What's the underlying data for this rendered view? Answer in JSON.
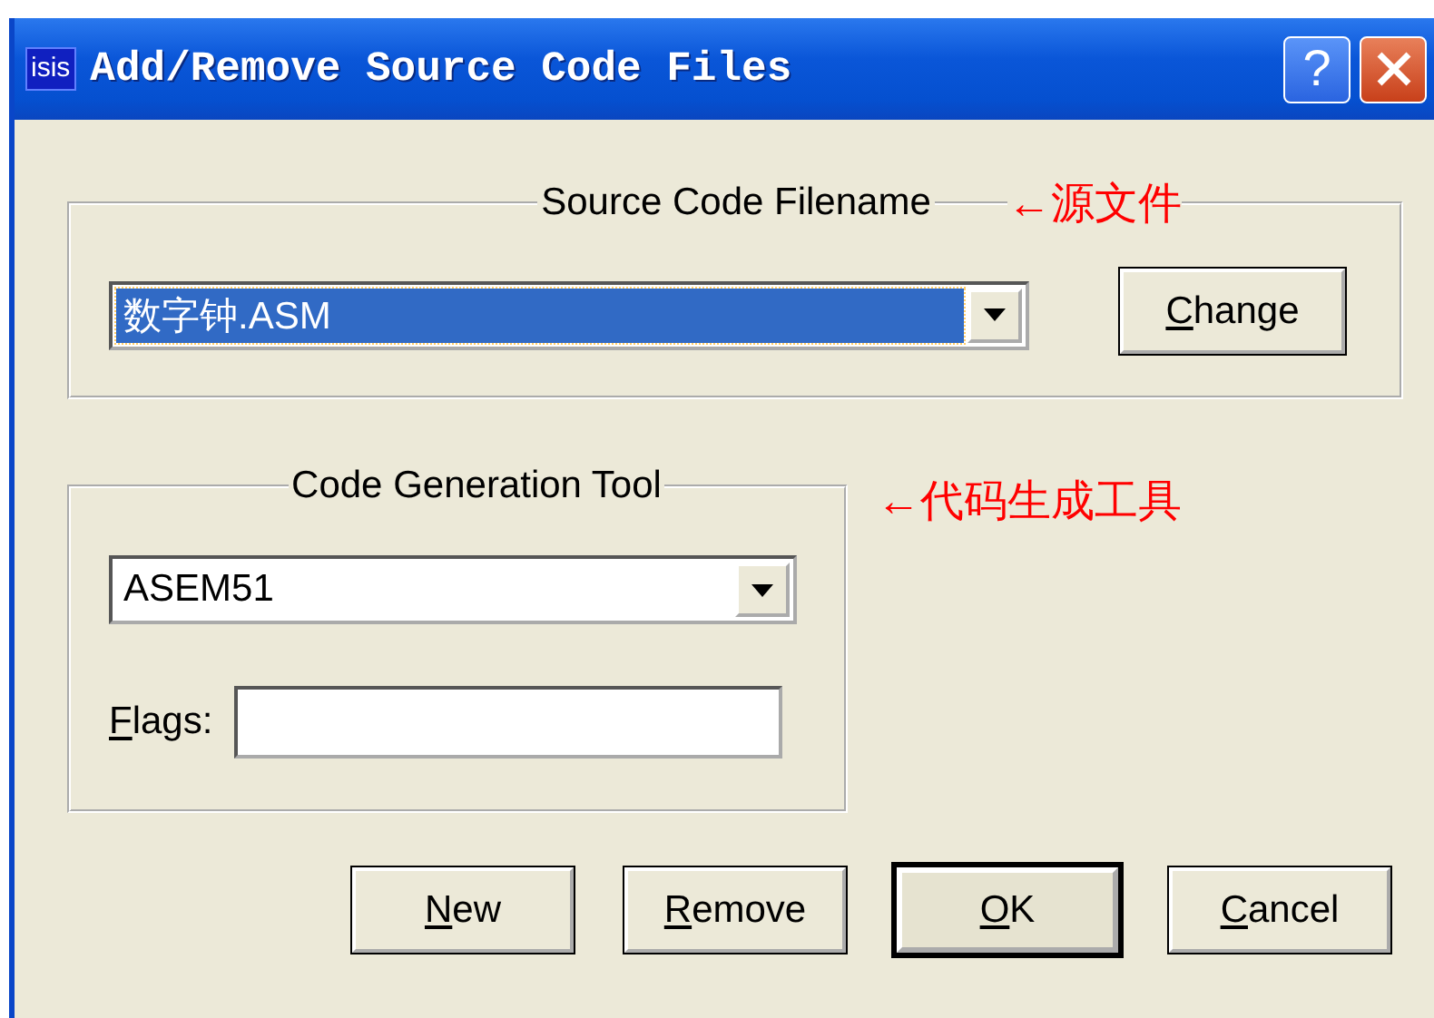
{
  "window": {
    "title": "Add/Remove Source Code Files",
    "icon_label": "isis",
    "help_glyph": "?"
  },
  "source_group": {
    "legend": "Source Code Filename",
    "annotation": "←源文件",
    "file": {
      "value": "数字钟.ASM",
      "selected": true
    },
    "change_button": {
      "label": "Change",
      "mnemonic_first": true
    }
  },
  "tool_group": {
    "legend": "Code Generation Tool",
    "annotation": "←代码生成工具",
    "tool": {
      "value": "ASEM51",
      "selected": false
    },
    "flags": {
      "label": "Flags:",
      "mnemonic_first": true
    }
  },
  "buttons": [
    {
      "label": "New",
      "mnemonic_first": true,
      "default": false
    },
    {
      "label": "Remove",
      "mnemonic_first": true,
      "default": false
    },
    {
      "label": "OK",
      "mnemonic_first": true,
      "default": true
    },
    {
      "label": "Cancel",
      "mnemonic_first": true,
      "default": false
    }
  ]
}
